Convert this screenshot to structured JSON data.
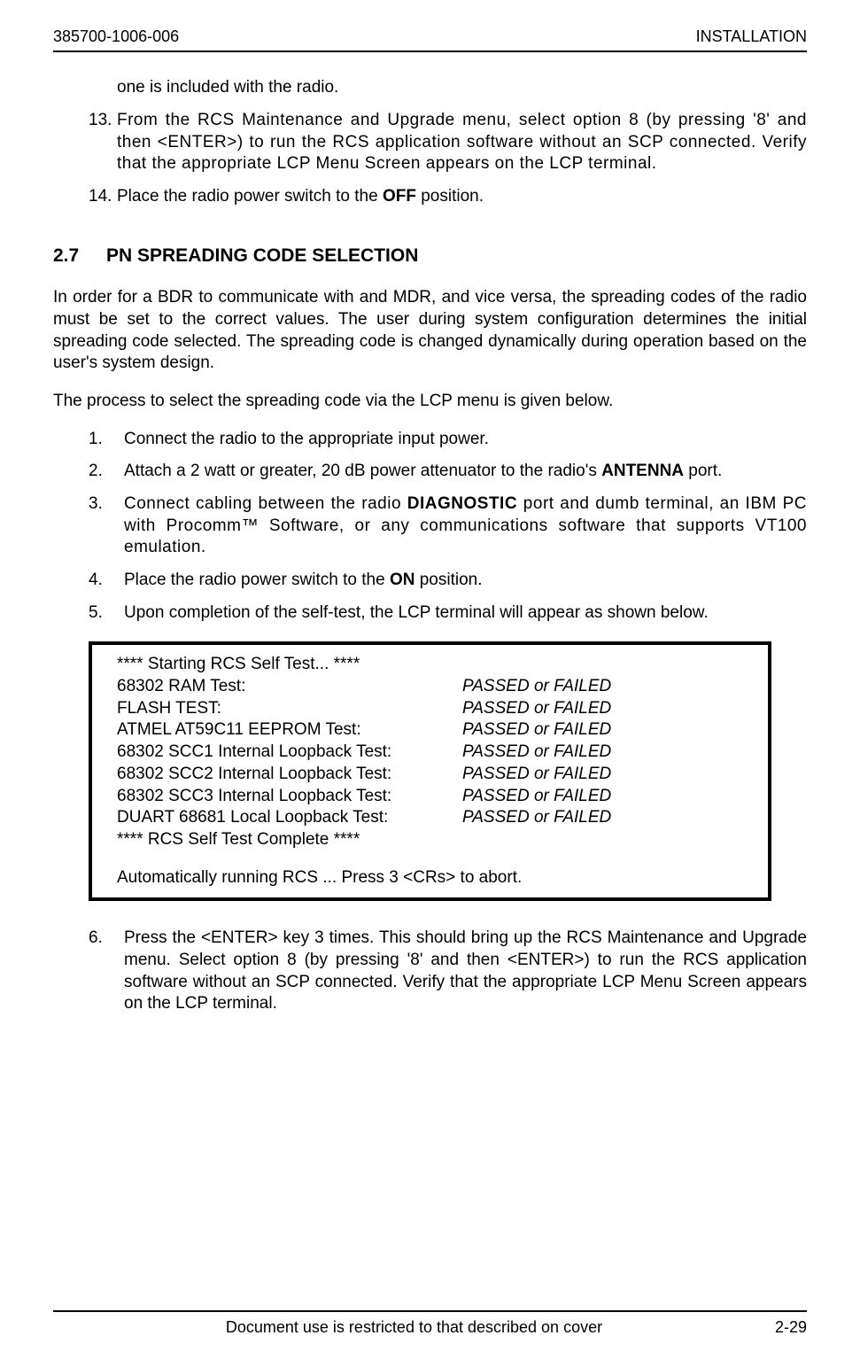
{
  "header": {
    "left": "385700-1006-006",
    "right": "INSTALLATION"
  },
  "continued_text": "one is included with the radio.",
  "first_list": [
    {
      "num": "13.",
      "pre": "From the RCS Maintenance and Upgrade menu, select option 8 (by pressing '8' and then <ENTER>) to run the RCS application software without an SCP connected.  Verify that the appropriate LCP Menu Screen appears on the LCP terminal."
    },
    {
      "num": "14.",
      "pre": "Place the radio power switch to the ",
      "bold": "OFF",
      "post": " position."
    }
  ],
  "section": {
    "num": "2.7",
    "title": "PN SPREADING CODE SELECTION"
  },
  "body_para1": "In order for a BDR to communicate with and MDR, and vice versa, the spreading codes of the radio must be set to the correct values.  The user during system configuration determines the initial spreading code selected.  The spreading code is changed dynamically during operation based on the user's system design.",
  "body_para2": "The process to select the spreading code via the LCP menu is given below.",
  "second_list": [
    {
      "num": "1.",
      "text": "Connect the radio to the appropriate input power."
    },
    {
      "num": "2.",
      "pre": "Attach a 2 watt or greater, 20 dB power attenuator to the radio's ",
      "bold": "ANTENNA",
      "post": " port."
    },
    {
      "num": "3.",
      "pre": "Connect cabling between the radio ",
      "bold": "DIAGNOSTIC",
      "post": " port and dumb terminal, an IBM PC with Procomm™ Software, or any communications software that supports VT100 emulation."
    },
    {
      "num": "4.",
      "pre": "Place the radio power switch to the ",
      "bold": "ON",
      "post": " position."
    },
    {
      "num": "5.",
      "text": "Upon completion of the self-test, the LCP terminal will appear as shown below."
    }
  ],
  "terminal": {
    "start_line": "**** Starting RCS Self Test... ****",
    "rows": [
      {
        "label": "68302 RAM Test:",
        "result": "PASSED or FAILED"
      },
      {
        "label": "FLASH TEST:",
        "result": "PASSED or FAILED"
      },
      {
        "label": "ATMEL AT59C11 EEPROM Test:",
        "result": "PASSED or FAILED"
      },
      {
        "label": "68302 SCC1 Internal Loopback Test:",
        "result": "PASSED or FAILED"
      },
      {
        "label": "68302 SCC2 Internal Loopback Test:",
        "result": "PASSED or FAILED"
      },
      {
        "label": "68302 SCC3 Internal Loopback Test:",
        "result": "PASSED or FAILED"
      },
      {
        "label": "DUART 68681 Local Loopback Test:",
        "result": "PASSED or FAILED"
      }
    ],
    "end_line": "**** RCS Self Test Complete ****",
    "abort_line": "Automatically running RCS ... Press 3 <CRs> to abort."
  },
  "third_list": [
    {
      "num": "6.",
      "text": "Press the <ENTER> key 3 times.  This should bring up the RCS Maintenance and Upgrade menu. Select option 8 (by pressing '8' and then <ENTER>) to run the RCS application software without an SCP connected.  Verify that the appropriate LCP Menu Screen appears on the LCP terminal."
    }
  ],
  "footer": {
    "center": "Document use is restricted to that described on cover",
    "right": "2-29"
  }
}
